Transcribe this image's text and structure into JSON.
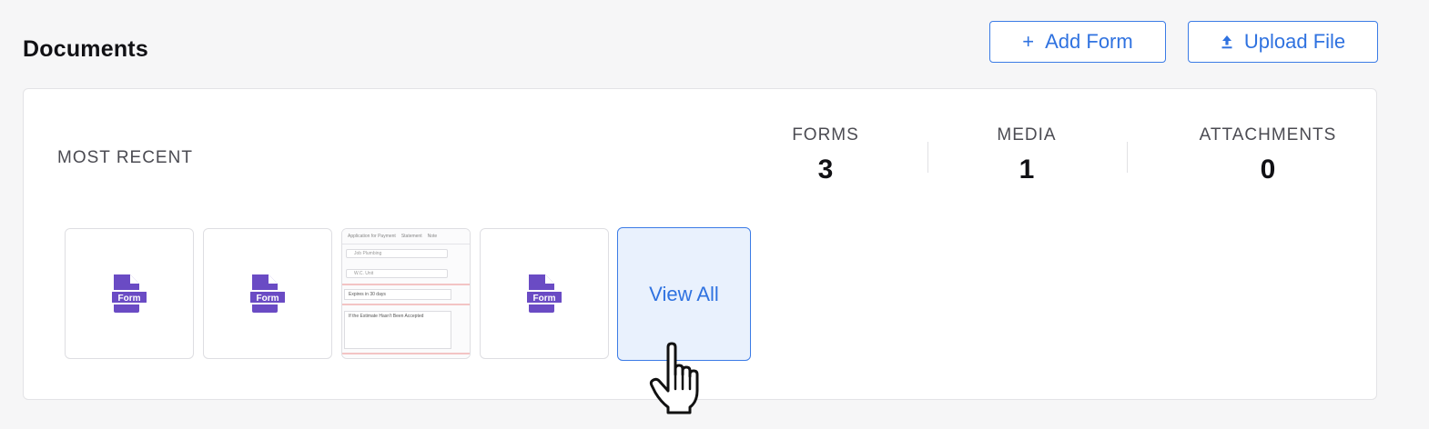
{
  "header": {
    "title": "Documents",
    "add_form_label": "Add Form",
    "add_form_glyph": "+",
    "upload_file_label": "Upload File",
    "upload_icon": "upload-icon"
  },
  "summary": {
    "section_label": "MOST RECENT",
    "stats": [
      {
        "label": "FORMS",
        "value": "3"
      },
      {
        "label": "MEDIA",
        "value": "1"
      },
      {
        "label": "ATTACHMENTS",
        "value": "0"
      }
    ]
  },
  "recent_items": [
    {
      "type": "form",
      "icon_text": "Form"
    },
    {
      "type": "form",
      "icon_text": "Form"
    },
    {
      "type": "preview",
      "preview_text": {
        "tabs": [
          "Application for Payment",
          "Statement",
          "Note"
        ],
        "field_1": "Job Plumbing",
        "field_2": "W.C. Unit",
        "select_1": "Expires in 30 days",
        "select_2": "If the Estimate Hasn't Been Accepted"
      }
    },
    {
      "type": "form",
      "icon_text": "Form"
    }
  ],
  "view_all_label": "View All",
  "colors": {
    "accent": "#2f72e0",
    "form_icon": "#6a4bc4",
    "view_all_bg": "#e9f1fd"
  }
}
